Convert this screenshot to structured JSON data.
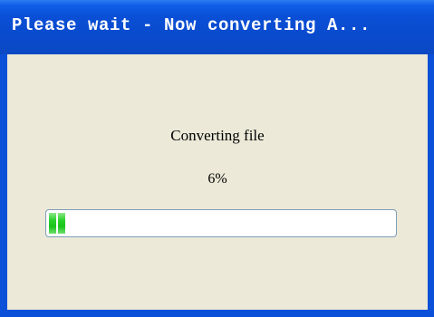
{
  "window": {
    "title": "Please wait - Now converting A..."
  },
  "dialog": {
    "status_text": "Converting file",
    "percent_text": "6%",
    "progress_fraction": 0.06
  },
  "colors": {
    "title_bar": "#0a4fd6",
    "client_background": "#ece9d8",
    "progress_fill": "#19c319",
    "progress_border": "#7f9db9"
  }
}
